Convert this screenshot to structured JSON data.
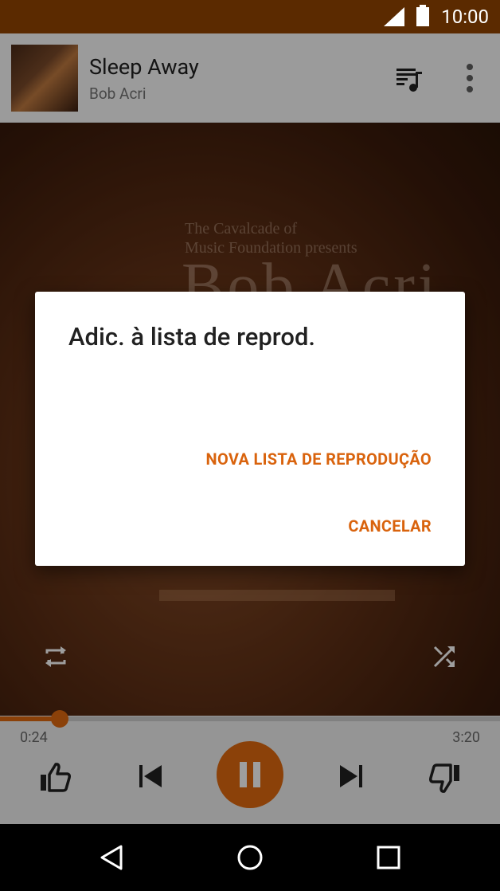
{
  "status_bar": {
    "time": "10:00"
  },
  "now_playing": {
    "title": "Sleep Away",
    "artist": "Bob Acri"
  },
  "album_art": {
    "text_line1": "The Cavalcade of",
    "text_line2": "Music Foundation presents",
    "text_big": "Bob Acri"
  },
  "player": {
    "elapsed": "0:24",
    "total": "3:20",
    "progress_fraction": 0.12
  },
  "dialog": {
    "title": "Adic. à lista de reprod.",
    "new_playlist_label": "NOVA LISTA DE REPRODUÇÃO",
    "cancel_label": "CANCELAR"
  },
  "colors": {
    "accent": "#e06a10",
    "status_bar": "#5b2a00"
  },
  "icons": {
    "signal": "signal-icon",
    "battery": "battery-icon",
    "queue": "queue-music-icon",
    "more": "more-vert-icon",
    "repeat": "repeat-icon",
    "shuffle": "shuffle-icon",
    "thumb_up": "thumb-up-icon",
    "previous": "skip-previous-icon",
    "pause": "pause-icon",
    "next": "skip-next-icon",
    "thumb_down": "thumb-down-icon",
    "back": "nav-back-icon",
    "home": "nav-home-icon",
    "recents": "nav-recents-icon"
  }
}
